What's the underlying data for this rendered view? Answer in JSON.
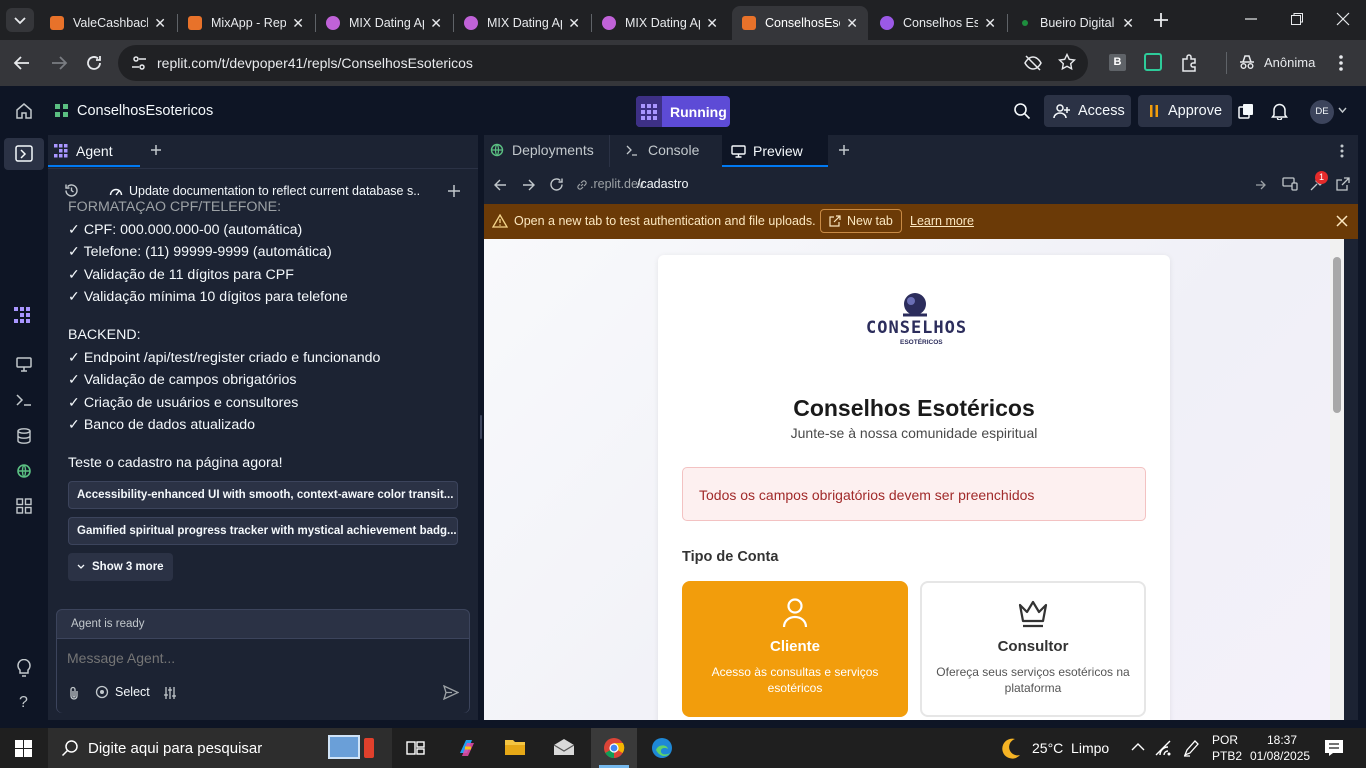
{
  "browser": {
    "tabs": [
      {
        "title": "ValeCashback",
        "fav": "#e8722a"
      },
      {
        "title": "MixApp - Replit",
        "fav": "#e8722a"
      },
      {
        "title": "MIX Dating App",
        "fav": "#c062d8"
      },
      {
        "title": "MIX Dating App",
        "fav": "#c062d8"
      },
      {
        "title": "MIX Dating App",
        "fav": "#c062d8"
      },
      {
        "title": "ConselhosEsotericos",
        "fav": "#e8722a"
      },
      {
        "title": "Conselhos Esotéricos",
        "fav": "#9b59e6"
      },
      {
        "title": "Bueiro Digital",
        "fav": "#1e8e3e"
      }
    ],
    "url": "replit.com/t/devpoper41/repls/ConselhosEsotericos",
    "profile": "Anônima",
    "ext_badge": "B"
  },
  "replit": {
    "project": "ConselhosEsotericos",
    "run_status": "Running",
    "access": "Access",
    "approve": "Approve",
    "avatar": "DE",
    "agent_tab": "Agent",
    "checkpoint": "Update documentation to reflect current database s...",
    "messages": [
      "FORMATAÇÃO CPF/TELEFONE:",
      "✓ CPF: 000.000.000-00 (automática)",
      "✓ Telefone: (11) 99999-9999 (automática)",
      "✓ Validação de 11 dígitos para CPF",
      "✓ Validação mínima 10 dígitos para telefone",
      "BACKEND:",
      "✓ Endpoint /api/test/register criado e funcionando",
      "✓ Validação de campos obrigatórios",
      "✓ Criação de usuários e consultores",
      "✓ Banco de dados atualizado",
      "Teste o cadastro na página agora!"
    ],
    "suggestions": [
      "Accessibility-enhanced UI with smooth, context-aware color transit...",
      "Gamified spiritual progress tracker with mystical achievement badg..."
    ],
    "show_more": "Show 3 more",
    "agent_status": "Agent is ready",
    "message_placeholder": "Message Agent...",
    "select_label": "Select",
    "tabs": [
      "Deployments",
      "Console",
      "Preview"
    ],
    "preview_url_prefix": ".replit.dev",
    "preview_url_path": "/cadastro",
    "notify_badge": "1",
    "banner_text": "Open a new tab to test authentication and file uploads.",
    "banner_button": "New tab",
    "banner_link": "Learn more"
  },
  "app": {
    "logo_text": "CONSELHOS",
    "logo_sub": "ESOTÉRICOS",
    "title": "Conselhos Esotéricos",
    "subtitle": "Junte-se à nossa comunidade espiritual",
    "error": "Todos os campos obrigatórios devem ser preenchidos",
    "account_type_label": "Tipo de Conta",
    "accounts": [
      {
        "title": "Cliente",
        "desc": "Acesso às consultas e serviços esotéricos",
        "selected": true
      },
      {
        "title": "Consultor",
        "desc": "Ofereça seus serviços esotéricos na plataforma",
        "selected": false
      }
    ]
  },
  "taskbar": {
    "search_placeholder": "Digite aqui para pesquisar",
    "weather": "25°C  Limpo",
    "lang": "POR",
    "layout": "PTB2",
    "time": "18:37",
    "date": "01/08/2025"
  },
  "colors": {
    "accent_orange": "#f29d0c",
    "replit_running": "#5d4bd6",
    "banner_bg": "#6b3a07"
  }
}
